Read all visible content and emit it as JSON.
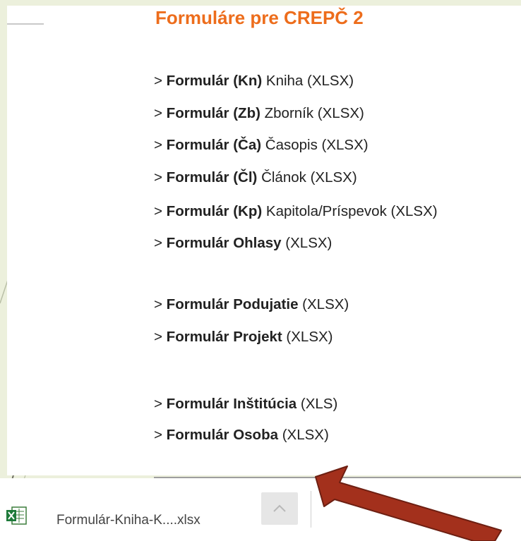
{
  "title": "Formuláre pre CREPČ 2",
  "forms": [
    {
      "bold": "Formulár (Kn)",
      "rest": "  Kniha (XLSX)"
    },
    {
      "bold": "Formulár (Zb)",
      "rest": "  Zborník (XLSX)"
    },
    {
      "bold": "Formulár (Ča)",
      "rest": " Časopis (XLSX)"
    },
    {
      "bold": "Formulár (Čl)",
      "rest": "  Článok (XLSX)"
    },
    {
      "bold": "Formulár (Kp)",
      "rest": " Kapitola/Príspevok (XLSX)"
    },
    {
      "bold": "Formulár Ohlasy",
      "rest": " (XLSX)"
    },
    {
      "bold": "Formulár Podujatie",
      "rest": " (XLSX)"
    },
    {
      "bold": "Formulár Projekt",
      "rest": " (XLSX)"
    },
    {
      "bold": "Formulár Inštitúcia",
      "rest": " (XLS)"
    },
    {
      "bold": "Formulár Osoba",
      "rest": " (XLSX)"
    }
  ],
  "link_prefix": "> ",
  "download_bar": {
    "filename": "Formulár-Kniha-K....xlsx",
    "file_icon": "excel-file-icon",
    "menu_icon": "chevron-up-icon"
  },
  "colors": {
    "title": "#ed6d1c",
    "arrow": "#a3301c",
    "background": "#ecf0dc"
  }
}
